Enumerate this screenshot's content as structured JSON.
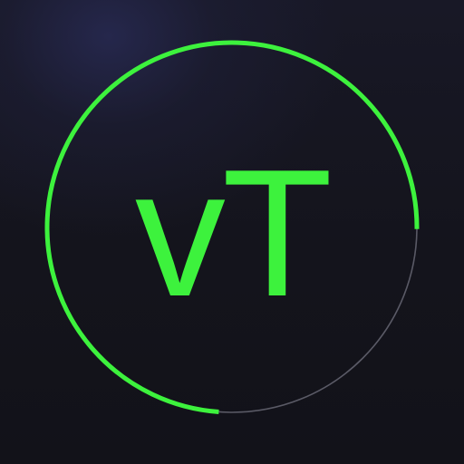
{
  "app_icon": {
    "monogram": "vT",
    "progress_fraction": 0.74,
    "colors": {
      "accent": "#3df23d",
      "track": "#5a5a66",
      "background": "#14141c",
      "background_glow": "#26284e"
    },
    "icon_name": "progress-ring-icon"
  }
}
